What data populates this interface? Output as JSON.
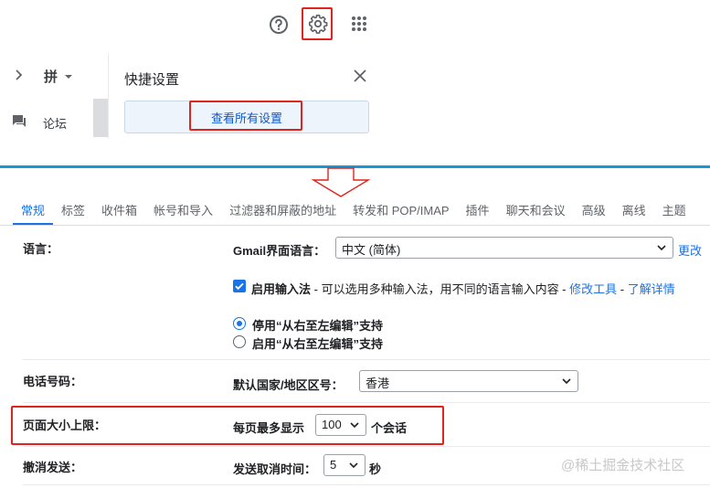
{
  "header": {
    "icons": [
      "help-icon",
      "settings-gear-icon",
      "apps-grid-icon"
    ]
  },
  "left_panel": {
    "input_tool_label": "拼",
    "forum_label": "论坛"
  },
  "quick_settings": {
    "title": "快捷设置",
    "view_all_label": "查看所有设置"
  },
  "tabs": [
    {
      "label": "常规",
      "active": true
    },
    {
      "label": "标签"
    },
    {
      "label": "收件箱"
    },
    {
      "label": "帐号和导入"
    },
    {
      "label": "过滤器和屏蔽的地址"
    },
    {
      "label": "转发和 POP/IMAP"
    },
    {
      "label": "插件"
    },
    {
      "label": "聊天和会议"
    },
    {
      "label": "高级"
    },
    {
      "label": "离线"
    },
    {
      "label": "主题"
    }
  ],
  "language": {
    "label": "语言：",
    "ui_language_label": "Gmail界面语言：",
    "ui_language_value": "中文 (简体)",
    "change_link": "更改",
    "input_method_label": "启用输入法",
    "input_method_desc": " - 可以选用多种输入法，用不同的语言输入内容 - ",
    "edit_tools_link": "修改工具",
    "sep": " - ",
    "learn_more_link": "了解详情",
    "rtl_off_label": "停用“从右至左编辑”支持",
    "rtl_on_label": "启用“从右至左编辑”支持"
  },
  "phone": {
    "label": "电话号码：",
    "country_label": "默认国家/地区区号：",
    "country_value": "香港"
  },
  "page_size": {
    "label": "页面大小上限：",
    "prefix": "每页最多显示",
    "value": "100",
    "suffix": "个会话"
  },
  "undo_send": {
    "label": "撤消发送：",
    "prefix": "发送取消时间：",
    "value": "5",
    "suffix": "秒"
  },
  "watermark": "@稀土掘金技术社区",
  "colors": {
    "highlight": "#e0231d",
    "accent": "#1a73e8",
    "divider": "#1a95d6"
  }
}
